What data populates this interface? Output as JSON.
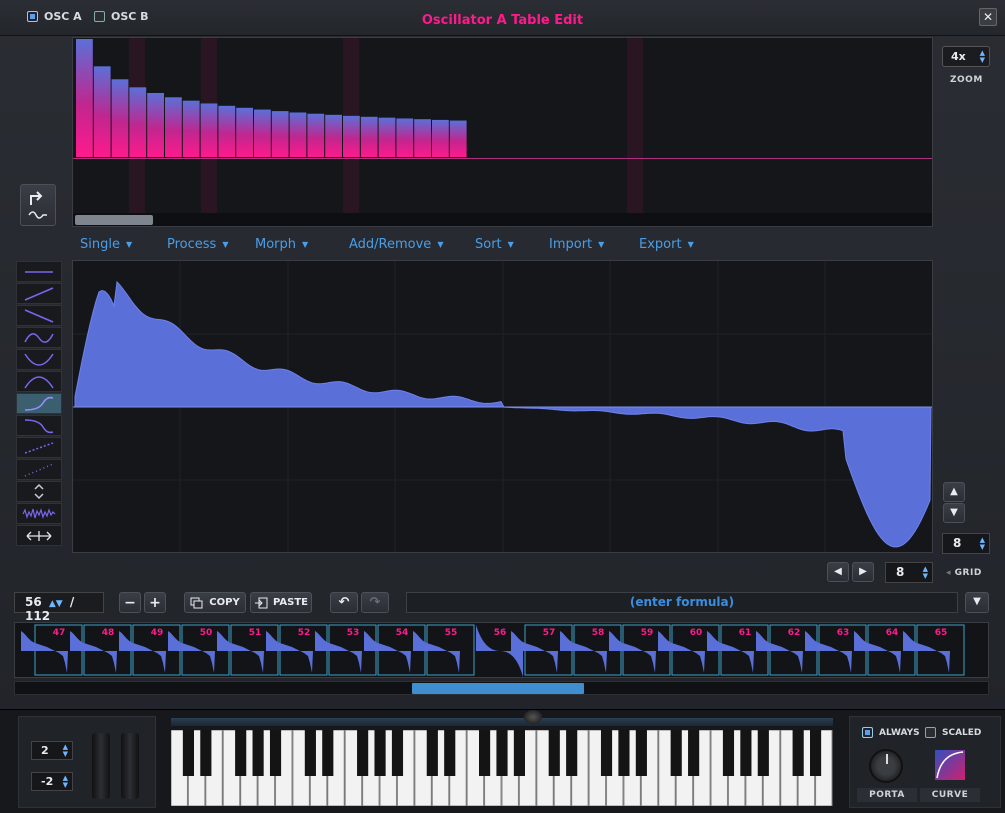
{
  "window": {
    "title": "Oscillator A Table Edit",
    "tabs": [
      {
        "label": "OSC A",
        "checked": true
      },
      {
        "label": "OSC B",
        "checked": false
      }
    ],
    "close_glyph": "✕"
  },
  "zoom": {
    "value": "4x",
    "label": "ZOOM"
  },
  "menu": [
    "Single",
    "Process",
    "Morph",
    "Add/Remove",
    "Sort",
    "Import",
    "Export"
  ],
  "menu_caret": "▼",
  "tools": [
    {
      "icon": "flat-line-icon"
    },
    {
      "icon": "ramp-up-icon"
    },
    {
      "icon": "ramp-down-icon"
    },
    {
      "icon": "sine-icon"
    },
    {
      "icon": "valley-curve-icon"
    },
    {
      "icon": "hill-curve-icon"
    },
    {
      "icon": "s-curve-icon",
      "selected": true
    },
    {
      "icon": "fall-curve-icon"
    },
    {
      "icon": "dotted-ramp-icon"
    },
    {
      "icon": "dotted-steps-icon"
    },
    {
      "icon": "expand-icon"
    },
    {
      "icon": "noise-icon"
    },
    {
      "icon": "stretch-icon"
    }
  ],
  "grid": {
    "value": "8",
    "label": "GRID"
  },
  "nav": {
    "value": "8"
  },
  "frame": {
    "current": "56",
    "total": "/ 112"
  },
  "buttons": {
    "minus": "−",
    "plus": "+",
    "copy": "COPY",
    "paste": "PASTE",
    "undo": "↶",
    "redo": "↷"
  },
  "formula": {
    "placeholder": "(enter formula)"
  },
  "frames": [
    "47",
    "48",
    "49",
    "50",
    "51",
    "52",
    "53",
    "54",
    "55",
    "56",
    "57",
    "58",
    "59",
    "60",
    "61",
    "62",
    "63",
    "64",
    "65"
  ],
  "selected_frame": "56",
  "keyboard": {
    "pitch_up": "2",
    "pitch_down": "-2",
    "always": {
      "label": "ALWAYS",
      "checked": true
    },
    "scaled": {
      "label": "SCALED",
      "checked": false
    },
    "porta": "PORTA",
    "curve": "CURVE"
  },
  "colors": {
    "accent": "#ff1a8c",
    "blue": "#4a9ee8",
    "wave": "#5a6fd8"
  }
}
